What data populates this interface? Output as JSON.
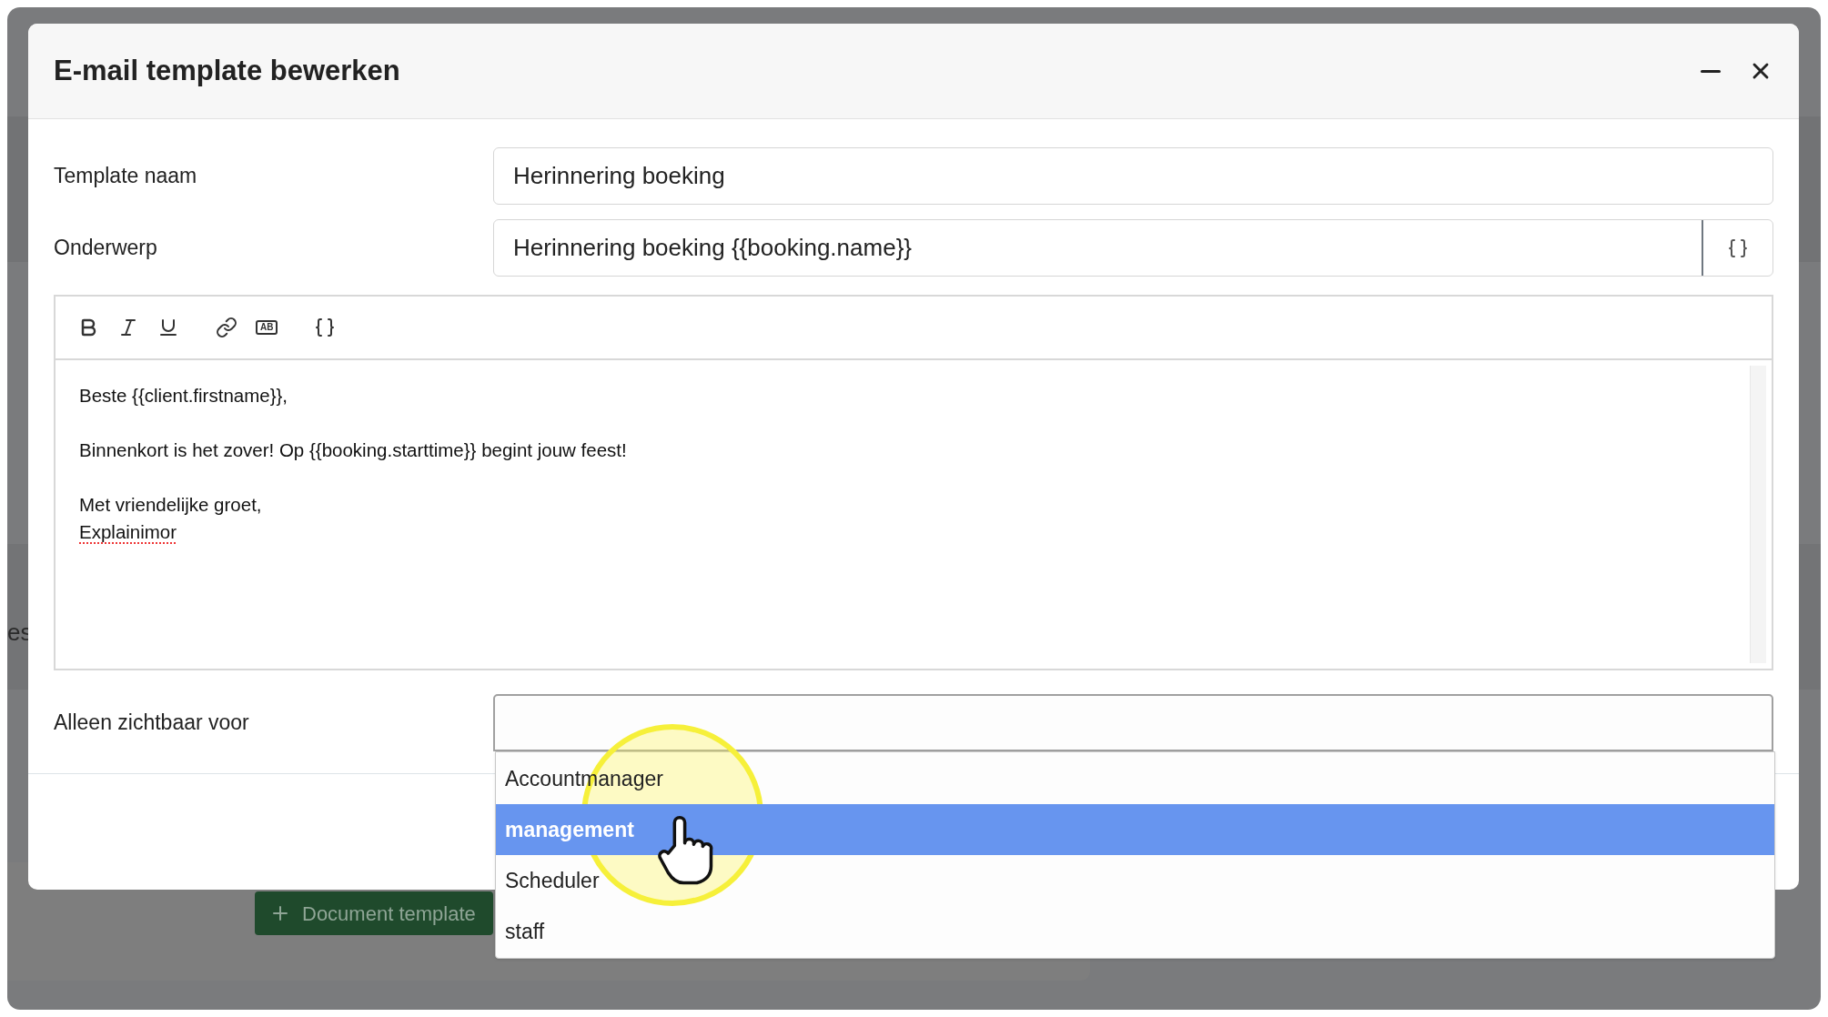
{
  "background": {
    "side_text": "es",
    "button": "Document template"
  },
  "dialog": {
    "title": "E-mail template bewerken"
  },
  "fields": [
    {
      "label": "Template naam",
      "value": "Herinnering boeking",
      "kind": "plain"
    },
    {
      "label": "Onderwerp",
      "value": "Herinnering boeking {{booking.name}}",
      "kind": "with-variable"
    }
  ],
  "editor": {
    "toolbar_badge": "AB",
    "paragraphs": [
      [
        {
          "text": "Beste {{client.firstname}},",
          "misspelled": false
        }
      ],
      [
        {
          "text": "Binnenkort is het zover! Op {{booking.starttime}} begint jouw feest!",
          "misspelled": false
        }
      ],
      [
        {
          "text": "Met vriendelijke groet,",
          "misspelled": false
        },
        {
          "text": "Explainimor",
          "misspelled": true
        }
      ]
    ]
  },
  "visibility": {
    "label": "Alleen zichtbaar voor",
    "options": [
      {
        "label": "Accountmanager",
        "selected": false
      },
      {
        "label": "management",
        "selected": true
      },
      {
        "label": "Scheduler",
        "selected": false
      },
      {
        "label": "staff",
        "selected": false
      }
    ]
  }
}
